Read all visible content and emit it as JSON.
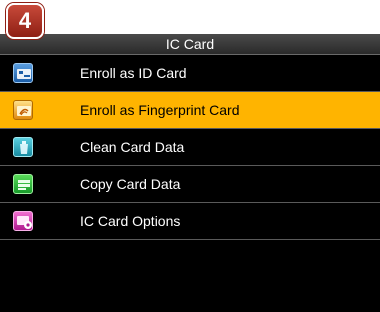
{
  "step_badge": "4",
  "title": "IC Card",
  "menu": {
    "items": [
      {
        "label": "Enroll as ID Card",
        "icon": "id-card-icon",
        "icon_color": "#2a6fc0"
      },
      {
        "label": "Enroll as Fingerprint Card",
        "icon": "fingerprint-card-icon",
        "icon_color": "#f0a020",
        "selected": true
      },
      {
        "label": "Clean Card Data",
        "icon": "clean-card-icon",
        "icon_color": "#20a0b8"
      },
      {
        "label": "Copy Card Data",
        "icon": "copy-card-icon",
        "icon_color": "#20b030"
      },
      {
        "label": "IC Card Options",
        "icon": "card-options-icon",
        "icon_color": "#d030b0"
      }
    ]
  },
  "colors": {
    "selected_bg": "#ffb400",
    "screen_bg": "#000000",
    "badge": "#a8301f"
  }
}
